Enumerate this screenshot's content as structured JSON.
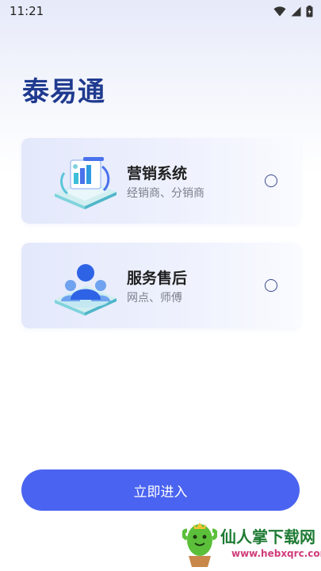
{
  "status_bar": {
    "time": "11:21"
  },
  "app": {
    "title": "泰易通"
  },
  "roles": [
    {
      "title": "营销系统",
      "subtitle": "经销商、分销商"
    },
    {
      "title": "服务售后",
      "subtitle": "网点、师傅"
    }
  ],
  "actions": {
    "enter_label": "立即进入"
  },
  "watermark": {
    "text": "仙人掌下载网",
    "url": "www.hebxqrc.com"
  },
  "colors": {
    "accent": "#4a63f0",
    "title": "#1f3a8f",
    "card_bg": "#e3e8fb"
  }
}
